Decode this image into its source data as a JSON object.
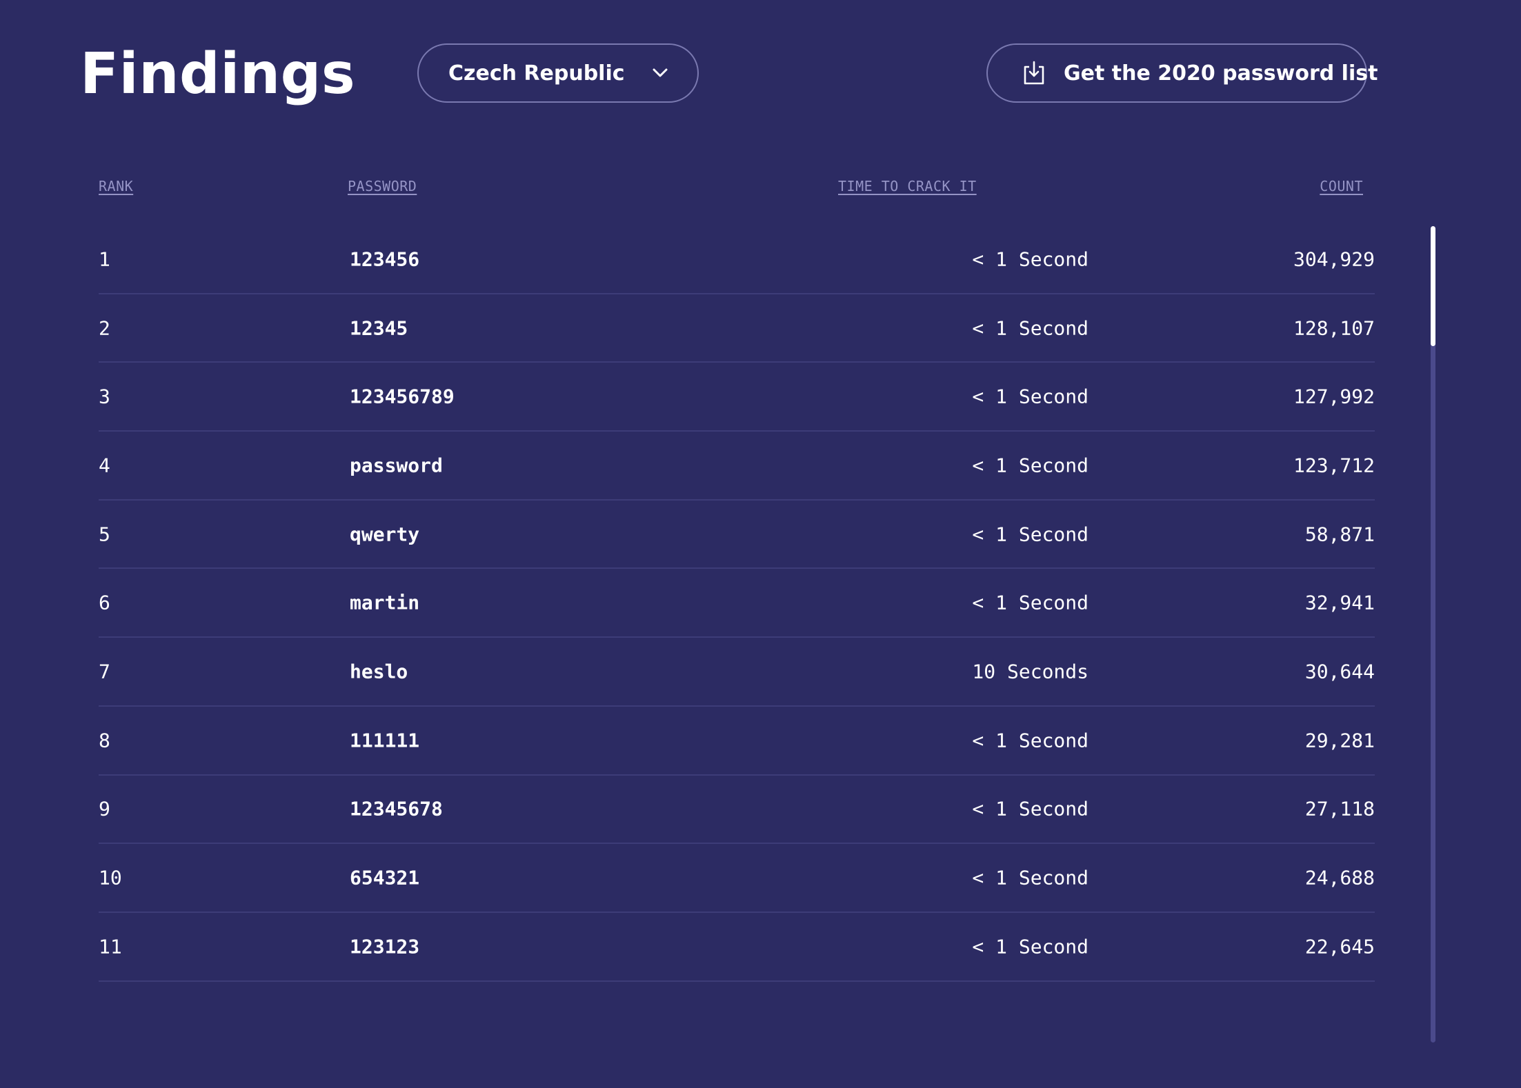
{
  "header": {
    "title": "Findings",
    "country_select": {
      "value": "Czech Republic"
    },
    "download_button": {
      "label": "Get the 2020 password list"
    }
  },
  "table": {
    "columns": {
      "rank": "RANK",
      "password": "PASSWORD",
      "time": "TIME TO CRACK IT",
      "count": "COUNT"
    },
    "rows": [
      {
        "rank": "1",
        "password": "123456",
        "time": "< 1 Second",
        "count": "304,929"
      },
      {
        "rank": "2",
        "password": "12345",
        "time": "< 1 Second",
        "count": "128,107"
      },
      {
        "rank": "3",
        "password": "123456789",
        "time": "< 1 Second",
        "count": "127,992"
      },
      {
        "rank": "4",
        "password": "password",
        "time": "< 1 Second",
        "count": "123,712"
      },
      {
        "rank": "5",
        "password": "qwerty",
        "time": "< 1 Second",
        "count": "58,871"
      },
      {
        "rank": "6",
        "password": "martin",
        "time": "< 1 Second",
        "count": "32,941"
      },
      {
        "rank": "7",
        "password": "heslo",
        "time": "10 Seconds",
        "count": "30,644"
      },
      {
        "rank": "8",
        "password": "111111",
        "time": "< 1 Second",
        "count": "29,281"
      },
      {
        "rank": "9",
        "password": "12345678",
        "time": "< 1 Second",
        "count": "27,118"
      },
      {
        "rank": "10",
        "password": "654321",
        "time": "< 1 Second",
        "count": "24,688"
      },
      {
        "rank": "11",
        "password": "123123",
        "time": "< 1 Second",
        "count": "22,645"
      }
    ]
  },
  "icons": {
    "chevron": "chevron-down-icon",
    "download": "download-icon"
  },
  "colors": {
    "background": "#2c2b63",
    "border": "#7a79b0",
    "header_text": "#9594c6",
    "row_divider": "#3d3c78",
    "text": "#ffffff"
  },
  "scrollbar": {
    "position": 0
  }
}
